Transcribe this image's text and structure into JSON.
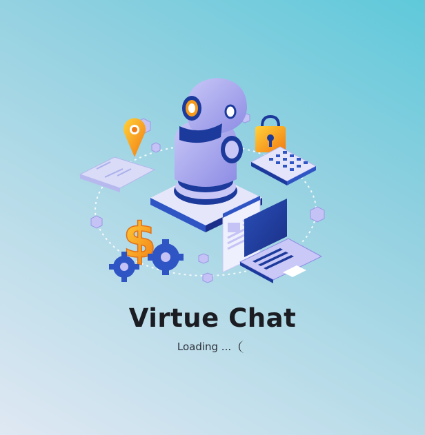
{
  "app": {
    "title": "Virtue Chat",
    "loading_text": "Loading ..."
  },
  "illustration": {
    "subject": "robot-assistant-illustration",
    "elements": [
      "robot",
      "location-pin",
      "map",
      "padlock",
      "calculator",
      "dollar-sign",
      "gears",
      "browser-window",
      "laptop",
      "cubes"
    ]
  },
  "colors": {
    "title": "#1b1d22",
    "background_start": "#dfe8f3",
    "background_end": "#5ec9da",
    "robot_primary": "#8f8fe8",
    "robot_dark": "#1f3f9c",
    "accent_orange": "#f59a1a",
    "spinner": "#111111"
  },
  "icons": {
    "spinner": "loading-spinner-icon"
  }
}
